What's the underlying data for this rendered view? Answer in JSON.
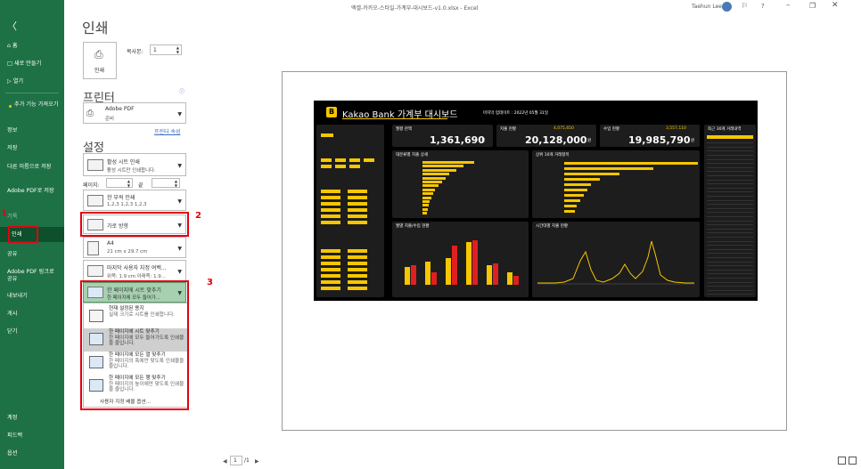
{
  "window": {
    "title": "엑셀-카카오-스타일-가계부-대시보드-v1.0.xlsx  -  Excel",
    "user": "Taehun Lee",
    "help": "?"
  },
  "sidebar": {
    "items": [
      {
        "label": "홈"
      },
      {
        "label": "새로 만들기"
      },
      {
        "label": "열기"
      },
      {
        "label": "추가 기능 가져오기"
      },
      {
        "label": "정보"
      },
      {
        "label": "저장"
      },
      {
        "label": "다른 이름으로 저장"
      },
      {
        "label": "Adobe PDF로 저장"
      },
      {
        "label": "기록"
      },
      {
        "label": "인쇄"
      },
      {
        "label": "공유"
      },
      {
        "label": "Adobe PDF 링크로 공유"
      },
      {
        "label": "내보내기"
      },
      {
        "label": "게시"
      },
      {
        "label": "닫기"
      },
      {
        "label": "계정"
      },
      {
        "label": "피드백"
      },
      {
        "label": "옵션"
      }
    ],
    "marker": "1"
  },
  "print": {
    "title": "인쇄",
    "button_label": "인쇄",
    "copies_label": "복사본:",
    "copies_value": "1",
    "printer_heading": "프린터",
    "printer_name": "Adobe PDF",
    "printer_status": "준비",
    "printer_props": "프린터 속성",
    "settings_heading": "설정",
    "active_sheets_title": "활성 시트 인쇄",
    "active_sheets_sub": "활성 시트만 인쇄합니다.",
    "pages_label": "페이지:",
    "to_label": "끝",
    "duplex_title": "한 부씩 인쇄",
    "duplex_sub": "1,2,3    1,2,3    1,2,3",
    "orientation": "가로 방향",
    "paper_title": "A4",
    "paper_sub": "21 cm x 29.7 cm",
    "margins_title": "마지막 사용자 지정 여백...",
    "margins_sub": "위쪽: 1.9 cm 아래쪽: 1.9...",
    "scaling_title": "한 페이지에 시트 맞추기",
    "scaling_sub": "한 페이지에 모두 들어가...",
    "markers": [
      "2",
      "3"
    ]
  },
  "scaling_menu": {
    "items": [
      {
        "title": "현재 설정된 용지",
        "desc": "실제 크기로 시트를 인쇄합니다."
      },
      {
        "title": "한 페이지에 시트 맞추기",
        "desc": "한 페이지에 모두 들어가도록 인쇄물을 줄입니다."
      },
      {
        "title": "한 페이지에 모든 열 맞추기",
        "desc": "한 페이지의 폭에만 맞도록 인쇄물을 줄입니다."
      },
      {
        "title": "한 페이지에 모든 행 맞추기",
        "desc": "한 페이지의 높이에만 맞도록 인쇄물을 줄입니다."
      }
    ],
    "custom": "사용자 지정 배율 옵션..."
  },
  "preview": {
    "dashboard_title": "Kakao Bank 가계부 대시보드",
    "dashboard_logo": "B",
    "last_update": "마지막 업데이트 : 2022년 05월 31일",
    "balance_label": "월평 잔액",
    "balance_value": "1,361,690",
    "expense_label": "지출 현황",
    "expense_value": "20,128,000",
    "expense_prev": "4,075,650",
    "income_label": "수입 현황",
    "income_value": "19,985,790",
    "income_prev": "3,557,110",
    "unit": "원",
    "recent_label": "최근 30개 거래내역",
    "cat_panel": "대분류별 지출 상세",
    "top10_panel": "상위 10개 거래항목",
    "monthly_panel": "월별 지출/수입 현황",
    "hourly_panel": "시간대별 지출 현황",
    "page_current": "1",
    "page_total": "/1"
  }
}
